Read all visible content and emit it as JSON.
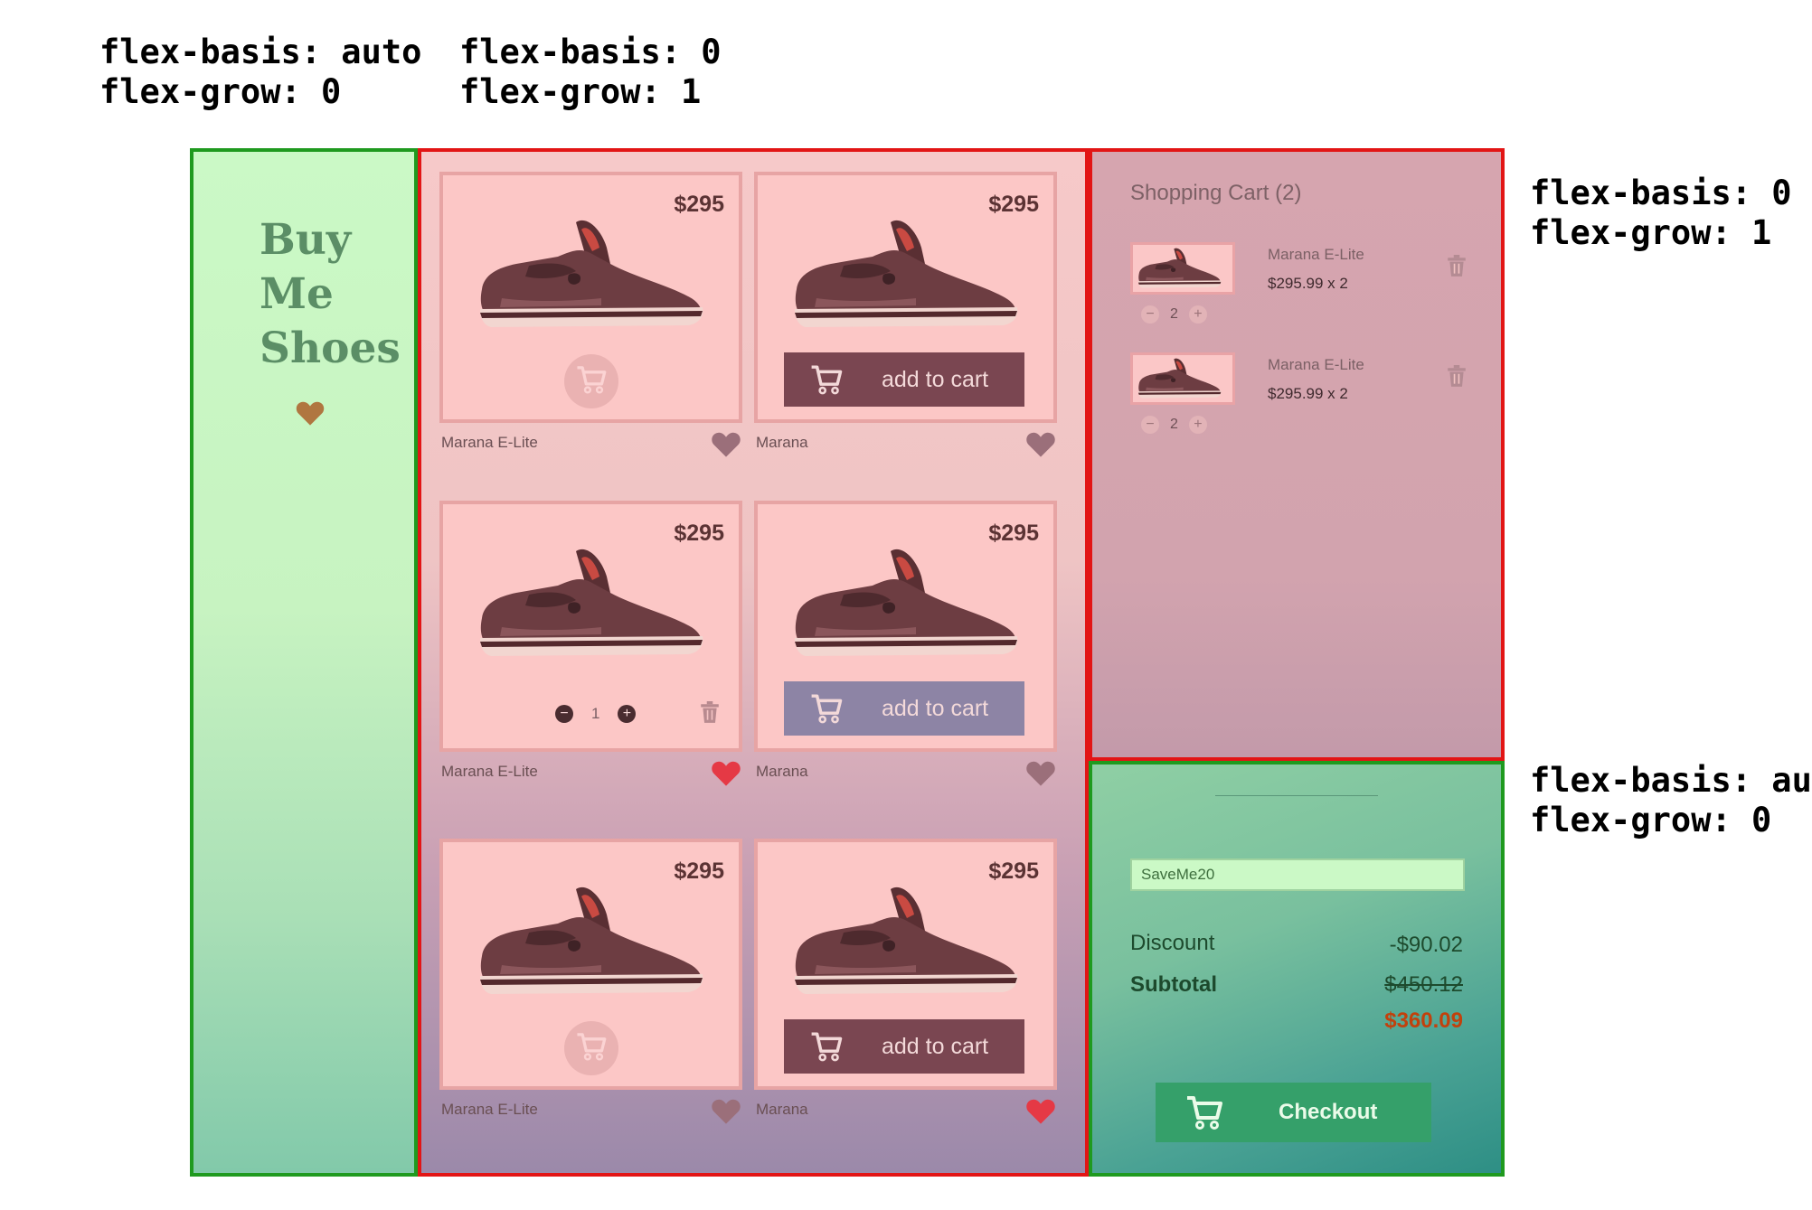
{
  "annotations": {
    "sidebar": {
      "basis": "flex-basis: auto",
      "grow": "flex-grow: 0"
    },
    "main": {
      "basis": "flex-basis: 0",
      "grow": "flex-grow: 1"
    },
    "cart": {
      "basis": "flex-basis: 0",
      "grow": "flex-grow: 1"
    },
    "checkout": {
      "basis": "flex-basis: auto",
      "grow": "flex-grow: 0"
    }
  },
  "sidebar": {
    "logo_lines": [
      "Buy",
      "Me",
      "Shoes"
    ],
    "heart_icon": "heart-icon",
    "heart_color": "#b07640"
  },
  "products": [
    {
      "price": "$295",
      "name": "Marana E-Lite",
      "action": "cart-circle",
      "favorite": false
    },
    {
      "price": "$295",
      "name": "Marana",
      "action": "add-to-cart",
      "button_label": "add to cart",
      "favorite": false
    },
    {
      "price": "$295",
      "name": "Marana E-Lite",
      "action": "stepper",
      "quantity": "1",
      "favorite": true
    },
    {
      "price": "$295",
      "name": "Marana",
      "action": "add-to-cart",
      "button_label": "add to cart",
      "favorite": false
    },
    {
      "price": "$295",
      "name": "Marana E-Lite",
      "action": "cart-circle",
      "favorite": false
    },
    {
      "price": "$295",
      "name": "Marana",
      "action": "add-to-cart",
      "button_label": "add to cart",
      "favorite": true
    }
  ],
  "cart": {
    "title": "Shopping Cart (2)",
    "items": [
      {
        "name": "Marana E-Lite",
        "price": "$295.99 x 2",
        "quantity": "2"
      },
      {
        "name": "Marana E-Lite",
        "price": "$295.99 x 2",
        "quantity": "2"
      }
    ]
  },
  "checkout": {
    "coupon": "SaveMe20",
    "discount_label": "Discount",
    "discount_value": "-$90.02",
    "subtotal_label": "Subtotal",
    "subtotal_value": "$450.12",
    "total_value": "$360.09",
    "button_label": "Checkout"
  },
  "colors": {
    "green_border": "#1f9a1f",
    "red_border": "#e21515",
    "favorite_active": "#e53945",
    "favorite_inactive": "#9b6f7a"
  }
}
